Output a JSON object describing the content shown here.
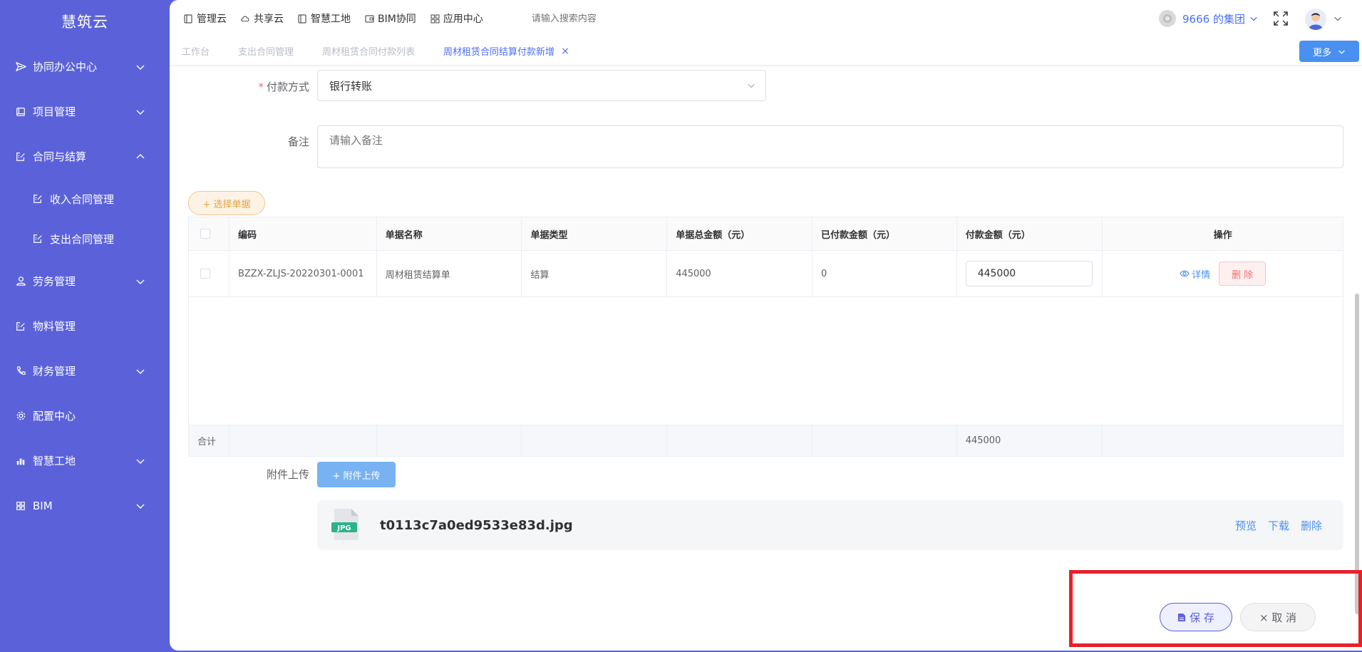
{
  "sidebar": {
    "brand": "慧筑云",
    "items": [
      {
        "label": "协同办公中心"
      },
      {
        "label": "项目管理"
      },
      {
        "label": "合同与结算"
      },
      {
        "label": "收入合同管理"
      },
      {
        "label": "支出合同管理"
      },
      {
        "label": "劳务管理"
      },
      {
        "label": "物料管理"
      },
      {
        "label": "财务管理"
      },
      {
        "label": "配置中心"
      },
      {
        "label": "智慧工地"
      },
      {
        "label": "BIM"
      }
    ]
  },
  "topbar": {
    "nav": [
      {
        "label": "管理云"
      },
      {
        "label": "共享云"
      },
      {
        "label": "智慧工地"
      },
      {
        "label": "BIM协同"
      },
      {
        "label": "应用中心"
      }
    ],
    "search_placeholder": "请输入搜索内容",
    "org_name": "9666 的集团"
  },
  "tabs": [
    {
      "label": "工作台"
    },
    {
      "label": "支出合同管理"
    },
    {
      "label": "周材租赁合同付款列表"
    },
    {
      "label": "周材租赁合同结算付款新增",
      "close": "×"
    }
  ],
  "more_button": "更多",
  "form": {
    "pay_method_label": "付款方式",
    "required_mark": "*",
    "pay_method_value": "银行转账",
    "remark_label": "备注",
    "remark_placeholder": "请输入备注"
  },
  "pick_button": "+ 选择单据",
  "table": {
    "headers": [
      "编码",
      "单据名称",
      "单据类型",
      "单据总金额（元）",
      "已付款金额（元）",
      "付款金额（元）",
      "操作"
    ],
    "rows": [
      {
        "code": "BZZX-ZLJS-20220301-0001",
        "name": "周材租赁结算单",
        "type": "结算",
        "total": "445000",
        "paid": "0",
        "pay_amount": "445000",
        "detail_label": "详情",
        "delete_label": "删 除"
      }
    ],
    "sum_label": "合计",
    "sum_pay_amount": "445000"
  },
  "attachment": {
    "label": "附件上传",
    "upload_button": "+ 附件上传",
    "file_badge": "JPG",
    "file_name": "t0113c7a0ed9533e83d.jpg",
    "preview": "预览",
    "download": "下载",
    "delete": "删除"
  },
  "actions": {
    "save": "保 存",
    "cancel": "× 取 消"
  },
  "colors": {
    "sidebar": "#5b62d9",
    "primary": "#4c6ef5",
    "danger": "#f56c6c",
    "warning": "#e6a23c",
    "highlight": "#e8202a"
  }
}
